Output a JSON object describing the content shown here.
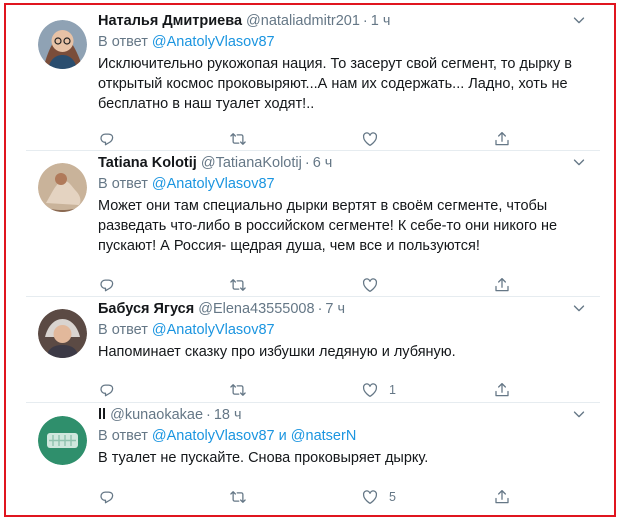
{
  "tweets": [
    {
      "name": "Наталья Дмитриева",
      "handle": "@nataliadmitr201",
      "time": "1 ч",
      "reply_prefix": "В ответ",
      "reply_to": "@AnatolyVlasov87",
      "reply_conj": "",
      "reply_to2": "",
      "text": "Исключительно рукожопая нация. То засерут свой сегмент, то дырку в открытый космос проковыряют...А нам их содержать... Ладно, хоть не бесплатно в наш туалет ходят!..",
      "likes": "",
      "avatar_icon": "woman-glasses-avatar"
    },
    {
      "name": "Tatiana Kolotij",
      "handle": "@TatianaKolotij",
      "time": "6 ч",
      "reply_prefix": "В ответ",
      "reply_to": "@AnatolyVlasov87",
      "reply_conj": "",
      "reply_to2": "",
      "text": "Может они там специально дырки вертят в своём сегменте, чтобы разведать что-либо в российском сегменте! К себе-то они никого не пускают! А Россия- щедрая душа, чем все и пользуются!",
      "likes": "",
      "avatar_icon": "painting-avatar"
    },
    {
      "name": "Бабуся Ягуся",
      "handle": "@Elena43555008",
      "time": "7 ч",
      "reply_prefix": "В ответ",
      "reply_to": "@AnatolyVlasov87",
      "reply_conj": "",
      "reply_to2": "",
      "text": "Напоминает сказку про избушки ледяную и лубяную.",
      "likes": "1",
      "avatar_icon": "elder-avatar"
    },
    {
      "name": "ll",
      "handle": "@kunaokakae",
      "time": "18 ч",
      "reply_prefix": "В ответ",
      "reply_to": "@AnatolyVlasov87",
      "reply_conj": "и",
      "reply_to2": "@natserN",
      "text": "В туалет не пускайте. Снова проковыряет дырку.",
      "likes": "5",
      "avatar_icon": "green-pattern-avatar"
    }
  ],
  "colors": {
    "frame_border": "#e0151f",
    "mention": "#1b95e0",
    "secondary_text": "#657786",
    "divider": "#e6ecf0"
  },
  "icons": {
    "reply": "reply-icon",
    "retweet": "retweet-icon",
    "like": "like-icon",
    "share": "share-icon",
    "caret": "chevron-down-icon"
  }
}
